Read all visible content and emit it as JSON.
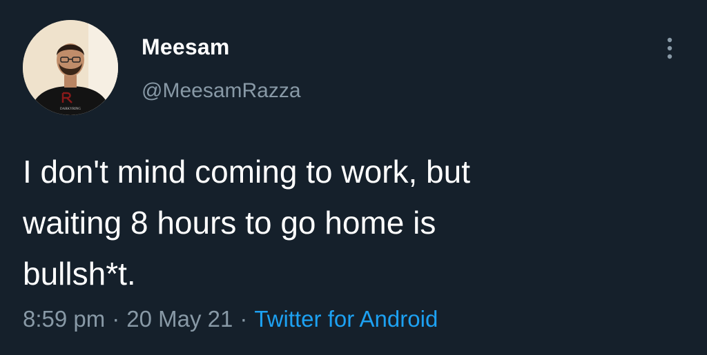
{
  "tweet": {
    "author": {
      "display_name": "Meesam",
      "handle": "@MeesamRazza",
      "avatar_icon": "profile-photo",
      "avatar_shirt_text": "DARKYRING"
    },
    "text": "I don't mind coming to work, but\nwaiting 8 hours to go home is\nbullsh*t.",
    "time": "8:59 pm",
    "separator": "·",
    "date": "20 May 21",
    "source": "Twitter for Android",
    "more_icon": "more-vertical-icon"
  },
  "colors": {
    "background": "#15202b",
    "primary_text": "#ffffff",
    "secondary_text": "#8899a6",
    "link": "#1da1f2"
  }
}
